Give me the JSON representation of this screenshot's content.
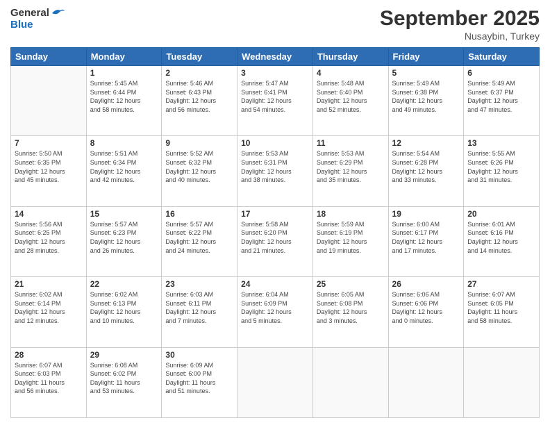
{
  "header": {
    "logo_general": "General",
    "logo_blue": "Blue",
    "month": "September 2025",
    "location": "Nusaybin, Turkey"
  },
  "days_of_week": [
    "Sunday",
    "Monday",
    "Tuesday",
    "Wednesday",
    "Thursday",
    "Friday",
    "Saturday"
  ],
  "weeks": [
    [
      {
        "day": "",
        "info": ""
      },
      {
        "day": "1",
        "info": "Sunrise: 5:45 AM\nSunset: 6:44 PM\nDaylight: 12 hours\nand 58 minutes."
      },
      {
        "day": "2",
        "info": "Sunrise: 5:46 AM\nSunset: 6:43 PM\nDaylight: 12 hours\nand 56 minutes."
      },
      {
        "day": "3",
        "info": "Sunrise: 5:47 AM\nSunset: 6:41 PM\nDaylight: 12 hours\nand 54 minutes."
      },
      {
        "day": "4",
        "info": "Sunrise: 5:48 AM\nSunset: 6:40 PM\nDaylight: 12 hours\nand 52 minutes."
      },
      {
        "day": "5",
        "info": "Sunrise: 5:49 AM\nSunset: 6:38 PM\nDaylight: 12 hours\nand 49 minutes."
      },
      {
        "day": "6",
        "info": "Sunrise: 5:49 AM\nSunset: 6:37 PM\nDaylight: 12 hours\nand 47 minutes."
      }
    ],
    [
      {
        "day": "7",
        "info": "Sunrise: 5:50 AM\nSunset: 6:35 PM\nDaylight: 12 hours\nand 45 minutes."
      },
      {
        "day": "8",
        "info": "Sunrise: 5:51 AM\nSunset: 6:34 PM\nDaylight: 12 hours\nand 42 minutes."
      },
      {
        "day": "9",
        "info": "Sunrise: 5:52 AM\nSunset: 6:32 PM\nDaylight: 12 hours\nand 40 minutes."
      },
      {
        "day": "10",
        "info": "Sunrise: 5:53 AM\nSunset: 6:31 PM\nDaylight: 12 hours\nand 38 minutes."
      },
      {
        "day": "11",
        "info": "Sunrise: 5:53 AM\nSunset: 6:29 PM\nDaylight: 12 hours\nand 35 minutes."
      },
      {
        "day": "12",
        "info": "Sunrise: 5:54 AM\nSunset: 6:28 PM\nDaylight: 12 hours\nand 33 minutes."
      },
      {
        "day": "13",
        "info": "Sunrise: 5:55 AM\nSunset: 6:26 PM\nDaylight: 12 hours\nand 31 minutes."
      }
    ],
    [
      {
        "day": "14",
        "info": "Sunrise: 5:56 AM\nSunset: 6:25 PM\nDaylight: 12 hours\nand 28 minutes."
      },
      {
        "day": "15",
        "info": "Sunrise: 5:57 AM\nSunset: 6:23 PM\nDaylight: 12 hours\nand 26 minutes."
      },
      {
        "day": "16",
        "info": "Sunrise: 5:57 AM\nSunset: 6:22 PM\nDaylight: 12 hours\nand 24 minutes."
      },
      {
        "day": "17",
        "info": "Sunrise: 5:58 AM\nSunset: 6:20 PM\nDaylight: 12 hours\nand 21 minutes."
      },
      {
        "day": "18",
        "info": "Sunrise: 5:59 AM\nSunset: 6:19 PM\nDaylight: 12 hours\nand 19 minutes."
      },
      {
        "day": "19",
        "info": "Sunrise: 6:00 AM\nSunset: 6:17 PM\nDaylight: 12 hours\nand 17 minutes."
      },
      {
        "day": "20",
        "info": "Sunrise: 6:01 AM\nSunset: 6:16 PM\nDaylight: 12 hours\nand 14 minutes."
      }
    ],
    [
      {
        "day": "21",
        "info": "Sunrise: 6:02 AM\nSunset: 6:14 PM\nDaylight: 12 hours\nand 12 minutes."
      },
      {
        "day": "22",
        "info": "Sunrise: 6:02 AM\nSunset: 6:13 PM\nDaylight: 12 hours\nand 10 minutes."
      },
      {
        "day": "23",
        "info": "Sunrise: 6:03 AM\nSunset: 6:11 PM\nDaylight: 12 hours\nand 7 minutes."
      },
      {
        "day": "24",
        "info": "Sunrise: 6:04 AM\nSunset: 6:09 PM\nDaylight: 12 hours\nand 5 minutes."
      },
      {
        "day": "25",
        "info": "Sunrise: 6:05 AM\nSunset: 6:08 PM\nDaylight: 12 hours\nand 3 minutes."
      },
      {
        "day": "26",
        "info": "Sunrise: 6:06 AM\nSunset: 6:06 PM\nDaylight: 12 hours\nand 0 minutes."
      },
      {
        "day": "27",
        "info": "Sunrise: 6:07 AM\nSunset: 6:05 PM\nDaylight: 11 hours\nand 58 minutes."
      }
    ],
    [
      {
        "day": "28",
        "info": "Sunrise: 6:07 AM\nSunset: 6:03 PM\nDaylight: 11 hours\nand 56 minutes."
      },
      {
        "day": "29",
        "info": "Sunrise: 6:08 AM\nSunset: 6:02 PM\nDaylight: 11 hours\nand 53 minutes."
      },
      {
        "day": "30",
        "info": "Sunrise: 6:09 AM\nSunset: 6:00 PM\nDaylight: 11 hours\nand 51 minutes."
      },
      {
        "day": "",
        "info": ""
      },
      {
        "day": "",
        "info": ""
      },
      {
        "day": "",
        "info": ""
      },
      {
        "day": "",
        "info": ""
      }
    ]
  ]
}
